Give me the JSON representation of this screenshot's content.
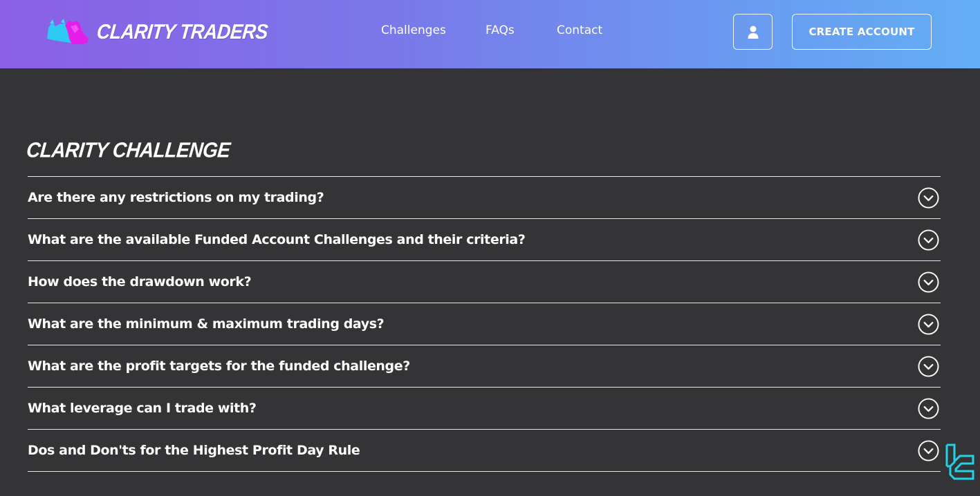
{
  "header": {
    "brand": "CLARITY TRADERS",
    "logo_icon": "bull-bear-logo-icon",
    "nav": [
      {
        "label": "Challenges"
      },
      {
        "label": "FAQs"
      },
      {
        "label": "Contact"
      }
    ],
    "user_icon": "user-icon",
    "create_account_label": "CREATE ACCOUNT",
    "gradient_start": "#8b5fe6",
    "gradient_end": "#63aef4"
  },
  "main": {
    "section_title": "CLARITY CHALLENGE",
    "faqs": [
      {
        "question": "Are there any restrictions on my trading?",
        "icon": "chevron-down-circle-icon"
      },
      {
        "question": "What are the available Funded Account Challenges and their criteria?",
        "icon": "chevron-down-circle-icon"
      },
      {
        "question": "How does the drawdown work?",
        "icon": "chevron-down-circle-icon"
      },
      {
        "question": "What are the minimum & maximum trading days?",
        "icon": "chevron-down-circle-icon"
      },
      {
        "question": "What are the profit targets for the funded challenge?",
        "icon": "chevron-down-circle-icon"
      },
      {
        "question": "What leverage can I trade with?",
        "icon": "chevron-down-circle-icon"
      },
      {
        "question": "Dos and Don'ts for the Highest Profit Day Rule",
        "icon": "chevron-down-circle-icon"
      }
    ],
    "background": "#343436"
  },
  "watermark": {
    "icon": "tc-watermark-icon",
    "color": "#22d3e6"
  }
}
